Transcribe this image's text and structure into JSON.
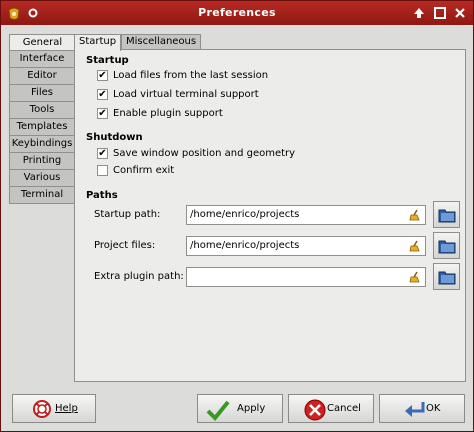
{
  "window": {
    "title": "Preferences"
  },
  "sidebar": {
    "items": [
      {
        "label": "General",
        "active": true
      },
      {
        "label": "Interface"
      },
      {
        "label": "Editor"
      },
      {
        "label": "Files"
      },
      {
        "label": "Tools"
      },
      {
        "label": "Templates"
      },
      {
        "label": "Keybindings"
      },
      {
        "label": "Printing"
      },
      {
        "label": "Various"
      },
      {
        "label": "Terminal"
      }
    ]
  },
  "tabs": [
    {
      "label": "Startup",
      "active": true
    },
    {
      "label": "Miscellaneous"
    }
  ],
  "startup": {
    "heading": "Startup",
    "options": [
      {
        "label": "Load files from the last session",
        "checked": true
      },
      {
        "label": "Load virtual terminal support",
        "checked": true
      },
      {
        "label": "Enable plugin support",
        "checked": true
      }
    ]
  },
  "shutdown": {
    "heading": "Shutdown",
    "options": [
      {
        "label": "Save window position and geometry",
        "checked": true
      },
      {
        "label": "Confirm exit",
        "checked": false
      }
    ]
  },
  "paths": {
    "heading": "Paths",
    "fields": [
      {
        "label": "Startup path:",
        "value": "/home/enrico/projects"
      },
      {
        "label": "Project files:",
        "value": "/home/enrico/projects"
      },
      {
        "label": "Extra plugin path:",
        "value": ""
      }
    ]
  },
  "buttons": {
    "help": "Help",
    "apply": "Apply",
    "cancel": "Cancel",
    "ok": "OK"
  }
}
